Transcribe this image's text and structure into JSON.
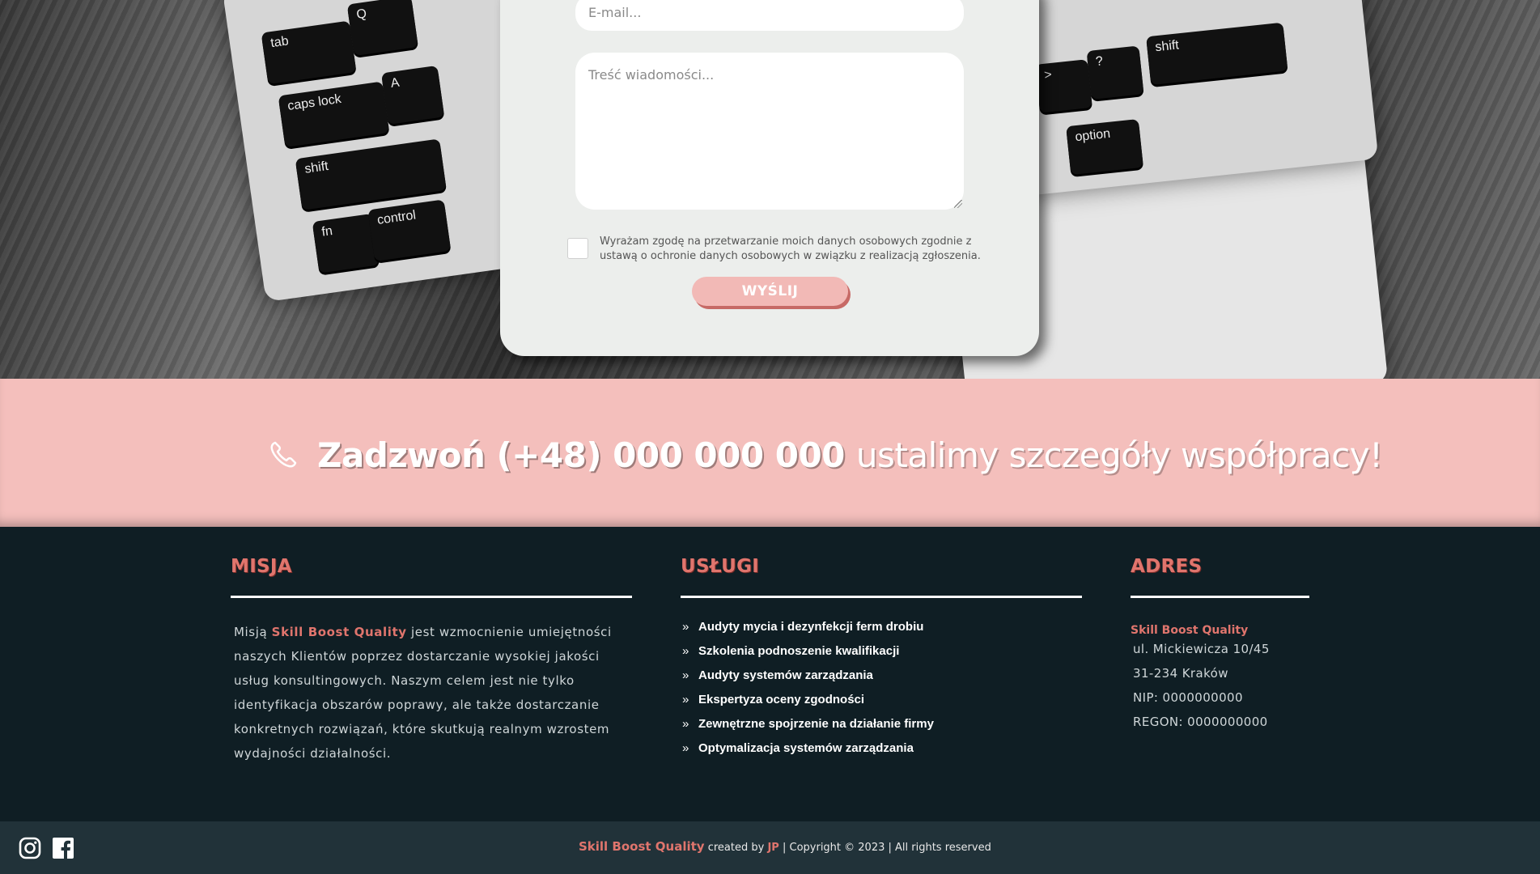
{
  "form": {
    "email_placeholder": "E-mail...",
    "message_placeholder": "Treść wiadomości...",
    "consent_text": "Wyrażam zgodę na przetwarzanie moich danych osobowych zgodnie z ustawą o ochronie danych osobowych w związku z realizacją zgłoszenia.",
    "submit_label": "WYŚLIJ"
  },
  "hero": {
    "keys": [
      "tab",
      "Q",
      "caps lock",
      "A",
      "shift",
      "fn",
      "control",
      ">",
      "?",
      "shift",
      "option"
    ]
  },
  "call_band": {
    "icon": "phone-icon",
    "strong_text": "Zadzwoń (+48) 000 000 000",
    "light_text": "ustalimy szczegóły współpracy!"
  },
  "footer": {
    "mission": {
      "heading": "MISJA",
      "text_before": "Misją",
      "brand": "Skill Boost Quality",
      "text_after": "jest wzmocnienie umiejętności naszych Klientów poprzez dostarczanie wysokiej jakości usług konsultingowych. Naszym celem jest nie tylko identyfikacja obszarów poprawy, ale także dostarczanie konkretnych rozwiązań, które skutkują realnym wzrostem wydajności działalności."
    },
    "services": {
      "heading": "USŁUGI",
      "bullet": "»",
      "items": [
        "Audyty mycia i dezynfekcji ferm drobiu",
        "Szkolenia podnoszenie kwalifikacji",
        "Audyty systemów zarządzania",
        "Ekspertyza oceny zgodności",
        "Zewnętrzne spojrzenie na działanie firmy",
        "Optymalizacja systemów zarządzania"
      ]
    },
    "address": {
      "heading": "ADRES",
      "company": "Skill Boost Quality",
      "street": "ul. Mickiewicza 10/45",
      "city": "31-234 Kraków",
      "nip": "NIP: 0000000000",
      "regon": "REGON: 0000000000"
    }
  },
  "bottom_bar": {
    "social": [
      "instagram-icon",
      "facebook-icon"
    ],
    "brand": "Skill Boost Quality",
    "created_by": "created by",
    "author": "JP",
    "copyright": "| Copyright © 2023 | All rights reserved"
  },
  "colors": {
    "accent": "#e0756d",
    "band": "#f4bfbc",
    "footer_bg": "#0f1e24",
    "bottom_bg": "#213239",
    "card_bg": "#eceeec"
  }
}
